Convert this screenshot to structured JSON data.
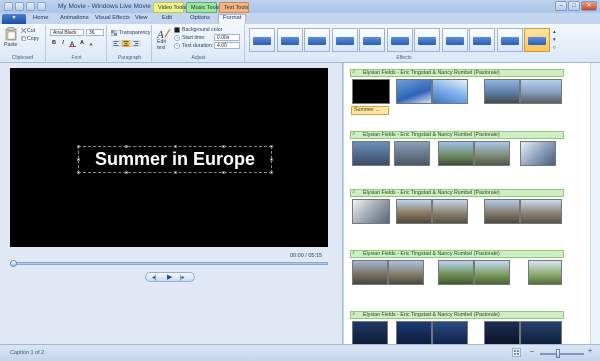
{
  "window": {
    "title": "My Movie - Windows Live Movie Maker",
    "contextual_tabs": {
      "video_tools": "Video Tools",
      "music_tools": "Music Tools",
      "text_tools": "Text Tools"
    },
    "buttons": {
      "minimize": "–",
      "maximize": "□",
      "close": "✕"
    }
  },
  "ribbon_tabs": [
    "Home",
    "Animations",
    "Visual Effects",
    "View",
    "Edit",
    "Options",
    "Format"
  ],
  "active_tab": "Format",
  "ribbon": {
    "clipboard": {
      "paste": "Paste",
      "cut": "Cut",
      "copy": "Copy",
      "label": "Clipboard"
    },
    "font": {
      "family": "Arial Black",
      "size": "36",
      "bold": "B",
      "italic": "I",
      "grow": "A",
      "shrink": "A",
      "label": "Font"
    },
    "paragraph": {
      "transparency": "Transparency",
      "label": "Paragraph"
    },
    "adjust": {
      "edit_text": "Edit text",
      "background_color": "Background color",
      "start_time_label": "Start time:",
      "start_time_value": "0.00s",
      "text_duration_label": "Text duration:",
      "text_duration_value": "4.00",
      "label": "Adjust"
    },
    "effects": {
      "label": "Effects",
      "count": 11,
      "selected_index": 10
    }
  },
  "preview": {
    "caption_text": "Summer in Europe",
    "timecode": "00:00 / 05:15",
    "seek_fraction": 0.0
  },
  "storyboard": {
    "rows": [
      {
        "music": "Elysian Fields - Eric Tingstad & Nancy Rumbel (Pastorale)",
        "caption": "Summer ..."
      },
      {
        "music": "Elysian Fields - Eric Tingstad & Nancy Rumbel (Pastorale)"
      },
      {
        "music": "Elysian Fields - Eric Tingstad & Nancy Rumbel (Pastorale)"
      },
      {
        "music": "Elysian Fields - Eric Tingstad & Nancy Rumbel (Pastorale)"
      },
      {
        "music": "Elysian Fields - Eric Tingstad & Nancy Rumbel (Pastorale)"
      }
    ],
    "music_icon": "music-note-icon"
  },
  "status": {
    "text": "Caption 1 of 2",
    "zoom_fraction": 0.4
  }
}
